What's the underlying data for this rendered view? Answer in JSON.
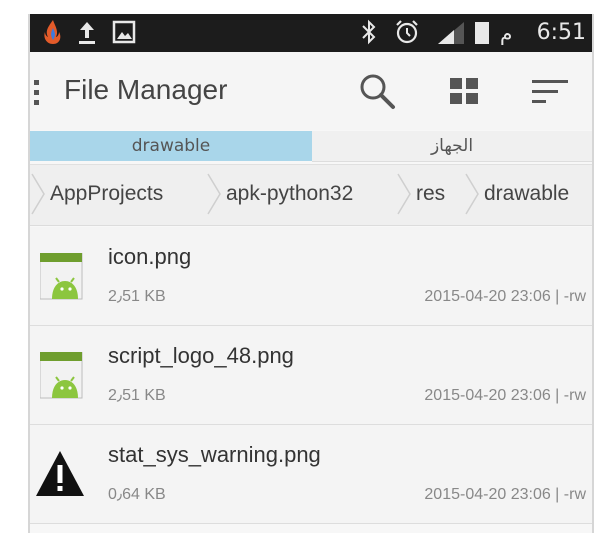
{
  "status_bar": {
    "time": "6:51",
    "am_pm": "م",
    "icons": [
      "flame-app-icon",
      "upload-icon",
      "image-icon",
      "bluetooth-icon",
      "alarm-icon",
      "signal-icon",
      "battery-icon"
    ]
  },
  "action_bar": {
    "title": "File Manager",
    "icons": [
      "overflow-menu-icon",
      "search-icon",
      "grid-view-icon",
      "sort-icon"
    ]
  },
  "tabs": [
    {
      "label": "drawable",
      "active": true
    },
    {
      "label": "الجهاز",
      "active": false
    }
  ],
  "breadcrumb": [
    "AppProjects",
    "apk-python32",
    "res",
    "drawable"
  ],
  "files": [
    {
      "name": "icon.png",
      "size": "2٫51 KB",
      "meta": "2015-04-20 23:06 | -rw",
      "icon": "android-image-icon"
    },
    {
      "name": "script_logo_48.png",
      "size": "2٫51 KB",
      "meta": "2015-04-20 23:06 | -rw",
      "icon": "android-image-icon"
    },
    {
      "name": "stat_sys_warning.png",
      "size": "0٫64 KB",
      "meta": "2015-04-20 23:06 | -rw",
      "icon": "warning-icon"
    }
  ],
  "colors": {
    "status_bar": "#1c1c1c",
    "active_tab": "#a9d6ea",
    "android_green": "#8cc63f"
  }
}
